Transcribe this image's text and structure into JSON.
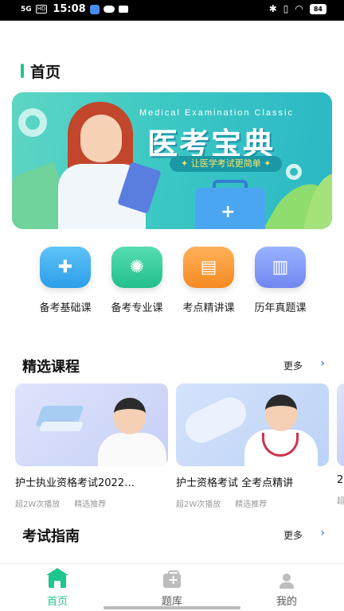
{
  "status_bar": {
    "signal": "5G",
    "hd": "HD",
    "time": "15:08",
    "battery": "84",
    "icons": [
      "signal-icon",
      "hd-icon",
      "app-notification-icon",
      "cloud-icon",
      "mail-icon",
      "bluetooth-icon",
      "vibrate-icon",
      "wifi-icon",
      "battery-icon"
    ]
  },
  "header": {
    "title": "首页",
    "accent_color": "#1ec78f"
  },
  "banner": {
    "subtitle_en": "Medical Examination Classic",
    "title": "医考宝典",
    "slogan": "让医学考试更简单"
  },
  "categories": [
    {
      "label": "备考基础课",
      "icon": "medical-kit-icon",
      "color": "#2c9ee9"
    },
    {
      "label": "备考专业课",
      "icon": "virus-icon",
      "color": "#22bf8c"
    },
    {
      "label": "考点精讲课",
      "icon": "monitor-icon",
      "color": "#f58a22"
    },
    {
      "label": "历年真题课",
      "icon": "book-icon",
      "color": "#6f87f0"
    }
  ],
  "featured": {
    "title": "精选课程",
    "more": "更多",
    "courses": [
      {
        "title": "护士执业资格考试2022…",
        "plays": "超2W次播放",
        "tag": "精选推荐"
      },
      {
        "title": "护士资格考试 全考点精讲",
        "plays": "超2W次播放",
        "tag": "精选推荐"
      },
      {
        "title": "2",
        "plays": "超",
        "tag": ""
      }
    ]
  },
  "guide": {
    "title": "考试指南",
    "more": "更多"
  },
  "tabbar": {
    "tabs": [
      {
        "label": "首页",
        "icon": "home-icon",
        "active": true
      },
      {
        "label": "题库",
        "icon": "medical-kit-icon",
        "active": false
      },
      {
        "label": "我的",
        "icon": "user-icon",
        "active": false
      }
    ]
  }
}
